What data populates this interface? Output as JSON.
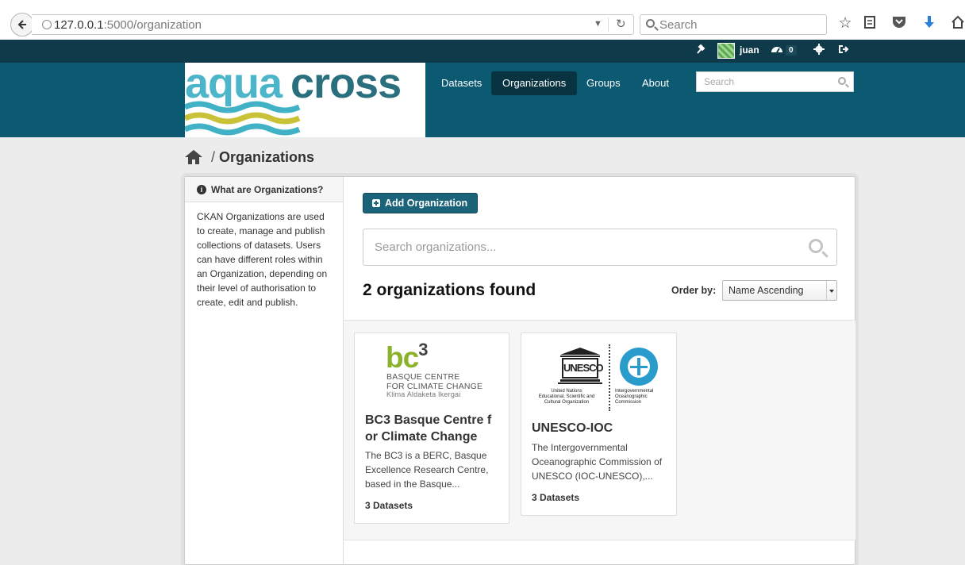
{
  "browser": {
    "url_host": "127.0.0.1",
    "url_path": ":5000/organization",
    "search_placeholder": "Search",
    "icons": [
      "back-icon",
      "globe-icon",
      "dropdown-icon",
      "reload-icon",
      "search-icon",
      "star-icon",
      "reading-list-icon",
      "pocket-icon",
      "download-icon",
      "home-icon"
    ]
  },
  "account_bar": {
    "username": "juan",
    "dashboard_count": "0",
    "icons": [
      "sysadmin-icon",
      "avatar",
      "dashboard-icon",
      "settings-icon",
      "logout-icon"
    ]
  },
  "site": {
    "logo_alt": "aquacross",
    "nav": [
      {
        "label": "Datasets",
        "active": false
      },
      {
        "label": "Organizations",
        "active": true
      },
      {
        "label": "Groups",
        "active": false
      },
      {
        "label": "About",
        "active": false
      }
    ],
    "search_placeholder": "Search"
  },
  "breadcrumb": {
    "separator": "/",
    "current": "Organizations"
  },
  "sidebar": {
    "heading": "What are Organizations?",
    "body": "CKAN Organizations are used to create, manage and publish collections of datasets. Users can have different roles within an Organization, depending on their level of authorisation to create, edit and publish."
  },
  "main": {
    "add_button": "Add Organization",
    "search_placeholder": "Search organizations...",
    "results_heading": "2 organizations found",
    "order_label": "Order by:",
    "order_value": "Name Ascending"
  },
  "organizations": [
    {
      "title_line1": "BC3 Basque Centre f",
      "title_line2": "or Climate Change",
      "desc_line1": "The BC3 is a BERC, Basque",
      "desc_line2": "Excellence Research Centre,",
      "desc_line3": "based in the Basque...",
      "datasets": "3 Datasets",
      "logo": {
        "mark": "bc",
        "sup": "3",
        "line1": "BASQUE CENTRE",
        "line2": "FOR CLIMATE CHANGE",
        "line3": "Klima Aldaketa Ikergai"
      }
    },
    {
      "title_line1": "UNESCO-IOC",
      "desc_line1": "The Intergovernmental",
      "desc_line2": "Oceanographic Commission of",
      "desc_line3": "UNESCO (IOC-UNESCO),...",
      "datasets": "3 Datasets",
      "logo": {
        "temple_text": "UNESCO",
        "left_caption_1": "United Nations",
        "left_caption_2": "Educational, Scientific and",
        "left_caption_3": "Cultural Organization",
        "right_caption_1": "Intergovernmental",
        "right_caption_2": "Oceanographic",
        "right_caption_3": "Commission"
      }
    }
  ],
  "colors": {
    "topbar": "#0f3a4a",
    "masthead": "#0c5a72",
    "nav_active": "#083441",
    "primary_button": "#1b6378",
    "bc3_green": "#8bb22c",
    "ioc_blue": "#2a9ccb"
  }
}
